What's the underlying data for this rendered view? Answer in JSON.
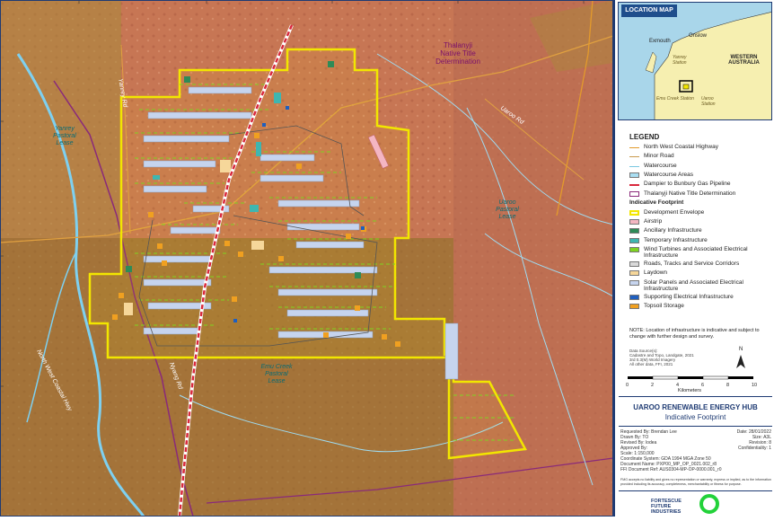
{
  "map": {
    "labels": {
      "native_title": "Thalanyji\nNative Title\nDetermination",
      "yanrey_lease": "Yanrey\nPastoral\nLease",
      "uaroo_lease": "Uaroo\nPastoral\nLease",
      "emu_creek_lease": "Emu Creek\nPastoral\nLease",
      "yanrey_road": "Yanrey Rd",
      "uaroo_road": "Uaroo Rd",
      "coast_highway_south": "North West Coastal Hwy",
      "nyang_road": "Nyang Rd"
    },
    "colors": {
      "terrain": "#c9785a",
      "overlay": "#9a7a2a",
      "envelope": "#f2e600",
      "pipeline": "#d9283c",
      "watercourse": "#6ec8e6",
      "minor_road": "#e0a040",
      "native_title_line": "#8a2a7a"
    }
  },
  "location_map": {
    "heading": "LOCATION MAP",
    "places": [
      "Exmouth",
      "Onslow",
      "Yanrey Station",
      "WESTERN AUSTRALIA",
      "Emu Creek Station",
      "Uaroo Station"
    ]
  },
  "legend": {
    "title": "LEGEND",
    "items": [
      {
        "label": "North West Coastal Highway",
        "kind": "line",
        "color": "#e39a2c"
      },
      {
        "label": "Minor Road",
        "kind": "line",
        "color": "#c89a4e"
      },
      {
        "label": "Watercourse",
        "kind": "line",
        "color": "#79c7e0"
      },
      {
        "label": "Watercourse Areas",
        "kind": "fill",
        "color": "#a9def2"
      },
      {
        "label": "Dampier to Bunbury Gas Pipeline",
        "kind": "pipe",
        "color": "#d9283c"
      },
      {
        "label": "Thalanyji Native Title Determination",
        "kind": "outline",
        "color": "#8a2a7a"
      }
    ],
    "subheading": "Indicative Footprint",
    "footprint": [
      {
        "label": "Development Envelope",
        "kind": "outline-fill",
        "color": "#f2e600"
      },
      {
        "label": "Airstrip",
        "kind": "fill",
        "color": "#f4b6c2"
      },
      {
        "label": "Ancillary Infrastructure",
        "kind": "fill",
        "color": "#2e8b57"
      },
      {
        "label": "Temporary Infrastructure",
        "kind": "fill",
        "color": "#3fb6b0"
      },
      {
        "label": "Wind Turbines and Associated Electrical Infrastructure",
        "kind": "fill",
        "color": "#7ed321"
      },
      {
        "label": "Roads, Tracks and Service Corridors",
        "kind": "fill",
        "color": "#d9d9d9"
      },
      {
        "label": "Laydown",
        "kind": "fill",
        "color": "#f6d79a"
      },
      {
        "label": "Solar Panels and Associated Electrical Infrastructure",
        "kind": "fill",
        "color": "#c6d4ee"
      },
      {
        "label": "Supporting Electrical Infrastructure",
        "kind": "fill",
        "color": "#1f5fbf"
      },
      {
        "label": "Topsoil Storage",
        "kind": "fill",
        "color": "#f0a020"
      }
    ],
    "note": "NOTE: Location of infrastructure is indicative and subject to change with further design and survey."
  },
  "sources": "Data Source(s):\nCadastre and Topo, Landgate, 2021\n3rd 0.3(M) World Imagery\nAll other data, FFI, 2021",
  "scale_bar": {
    "ticks": [
      "0",
      "2",
      "4",
      "6",
      "8",
      "10"
    ],
    "unit": "Kilometers",
    "north": "N"
  },
  "title_block": {
    "title": "UAROO RENEWABLE ENERGY HUB",
    "subtitle": "Indicative Footprint",
    "requested_by": "Requested By: Brendan Lee",
    "drawn_by": "Drawn By: TO",
    "revised_by": "Revised By: lodea",
    "approved_by": "Approved By:",
    "scale": "Scale: 1:150,000",
    "coord_system": "Coordinate System: GDA 1994 MGA Zone 50",
    "doc_name": "Document Name: PXP00_MP_OP_0021.002_r8",
    "ffi_ref": "FFI Document Ref: AUS0304-MP-OP-0000.001_r0",
    "date": "Date: 28/01/2022",
    "size": "Size: A3L",
    "revision": "Revision: 8",
    "confidentiality": "Confidentiality: 1",
    "disclaimer": "FMG accepts no liability and gives no representation or warranty, express or implied, as to the information provided including its accuracy, completeness, merchantability or fitness for purpose.",
    "brand": "FORTESCUE\nFUTURE\nINDUSTRIES"
  }
}
